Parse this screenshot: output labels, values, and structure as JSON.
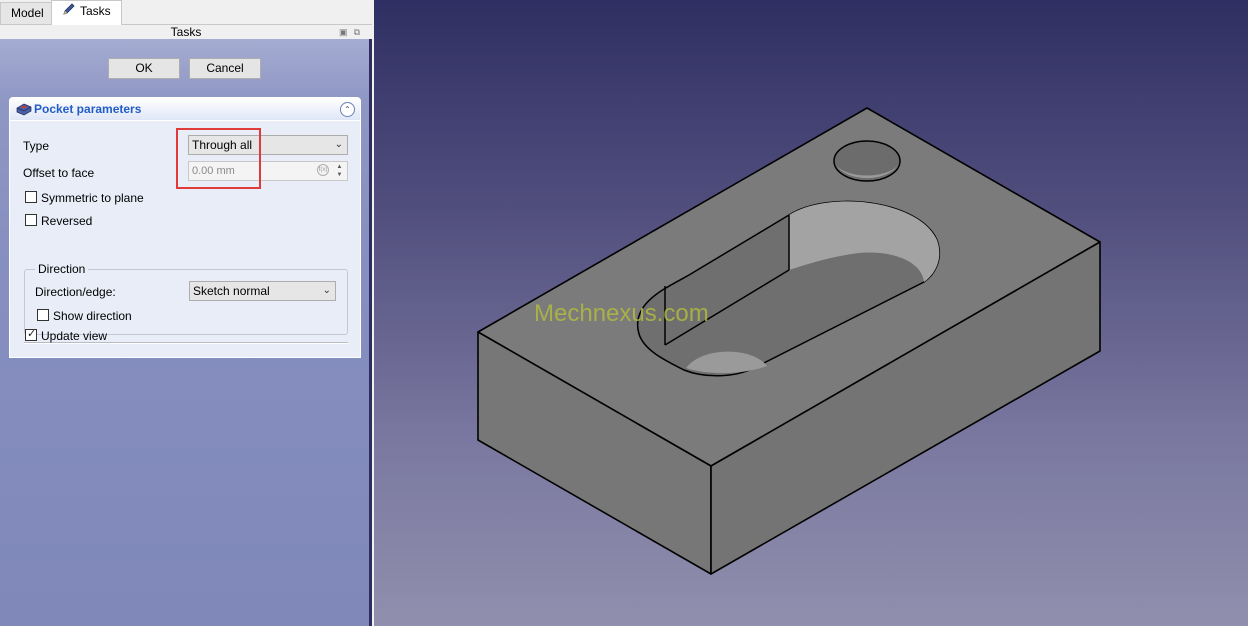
{
  "tabs": [
    {
      "label": "Model",
      "active": false
    },
    {
      "label": "Tasks",
      "active": true,
      "icon": "pencil-icon"
    }
  ],
  "tasks_header": "Tasks",
  "buttons": {
    "ok": "OK",
    "cancel": "Cancel"
  },
  "pocket": {
    "title": "Pocket parameters",
    "type_label": "Type",
    "type_value": "Through all",
    "offset_label": "Offset to face",
    "offset_value": "0.00 mm",
    "symmetric_label": "Symmetric to plane",
    "symmetric_checked": false,
    "reversed_label": "Reversed",
    "reversed_checked": false,
    "direction_group": "Direction",
    "direction_label": "Direction/edge:",
    "direction_value": "Sketch normal",
    "show_direction_label": "Show direction",
    "show_direction_checked": false,
    "update_view_label": "Update view",
    "update_view_checked": true
  },
  "watermark": "Mechnexus.com",
  "colors": {
    "highlight": "#e03a3a",
    "title_blue": "#215dc6",
    "part_gray": "#777777"
  }
}
